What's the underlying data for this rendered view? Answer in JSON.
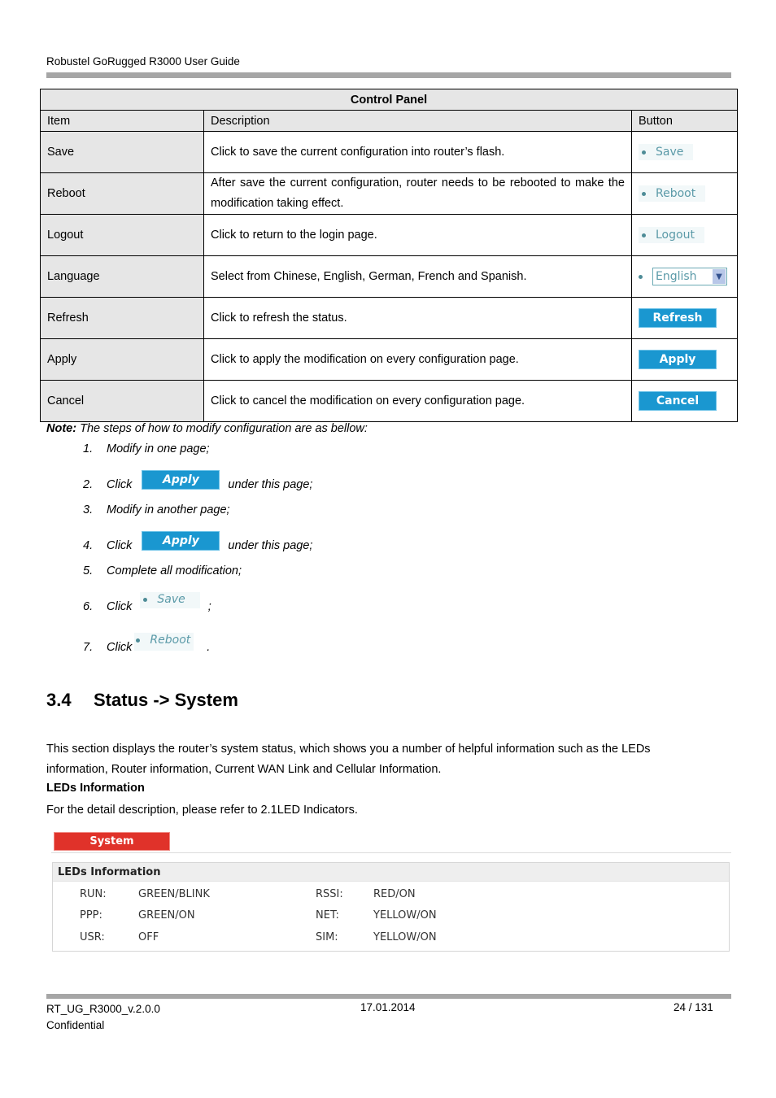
{
  "header": {
    "title": "Robustel GoRugged R3000 User Guide"
  },
  "control_panel": {
    "title": "Control Panel",
    "columns": [
      "Item",
      "Description",
      "Button"
    ],
    "rows": [
      {
        "item": "Save",
        "description": "Click to save the current configuration into router’s flash.",
        "button": "Save"
      },
      {
        "item": "Reboot",
        "description": "After save the current configuration, router needs to be rebooted to make the modification taking effect.",
        "button": "Reboot"
      },
      {
        "item": "Logout",
        "description": "Click to return to the login page.",
        "button": "Logout"
      },
      {
        "item": "Language",
        "description": "Select from Chinese, English, German, French and Spanish.",
        "button": "English"
      },
      {
        "item": "Refresh",
        "description": "Click to refresh the status.",
        "button": "Refresh"
      },
      {
        "item": "Apply",
        "description": "Click to apply the modification on every configuration page.",
        "button": "Apply"
      },
      {
        "item": "Cancel",
        "description": "Click to cancel the modification on every configuration page.",
        "button": "Cancel"
      }
    ]
  },
  "note": {
    "label": "Note:",
    "text": " The steps of how to modify configuration are as bellow:",
    "steps": [
      {
        "num": "1.",
        "text": "Modify in one page;"
      },
      {
        "num": "2.",
        "text": "Click",
        "button": "Apply",
        "after": "under this page;"
      },
      {
        "num": "3.",
        "text": "Modify in another page;"
      },
      {
        "num": "4.",
        "text": "Click",
        "button": "Apply",
        "after": "under this page;"
      },
      {
        "num": "5.",
        "text": "Complete all modification;"
      },
      {
        "num": "6.",
        "text": "Click",
        "button": "Save",
        "after": ";"
      },
      {
        "num": "7.",
        "text": "Click",
        "button": "Reboot",
        "after": "."
      }
    ]
  },
  "section": {
    "number": "3.4",
    "title": "Status -> System",
    "intro_line1": "This section displays the router’s system status, which shows you a number of helpful information such as the LEDs",
    "intro_line2": "information, Router information, Current WAN Link and Cellular Information.",
    "subheading": "LEDs Information",
    "subtext": "For the detail description, please refer to 2.1LED Indicators."
  },
  "system_panel": {
    "tab": "System",
    "box_title": "LEDs Information",
    "leds_left": [
      {
        "label": "RUN:",
        "value": "GREEN/BLINK"
      },
      {
        "label": "PPP:",
        "value": "GREEN/ON"
      },
      {
        "label": "USR:",
        "value": "OFF"
      }
    ],
    "leds_right": [
      {
        "label": "RSSI:",
        "value": "RED/ON"
      },
      {
        "label": "NET:",
        "value": "YELLOW/ON"
      },
      {
        "label": "SIM:",
        "value": "YELLOW/ON"
      }
    ]
  },
  "footer": {
    "doc_id": "RT_UG_R3000_v.2.0.0",
    "confidential": "Confidential",
    "date": "17.01.2014",
    "page": "24 / 131"
  },
  "colors": {
    "button_blue": "#1a97d0",
    "system_tab_red": "#e0322a",
    "link_teal": "#5b9aa8",
    "table_shade": "#e6e6e6"
  }
}
